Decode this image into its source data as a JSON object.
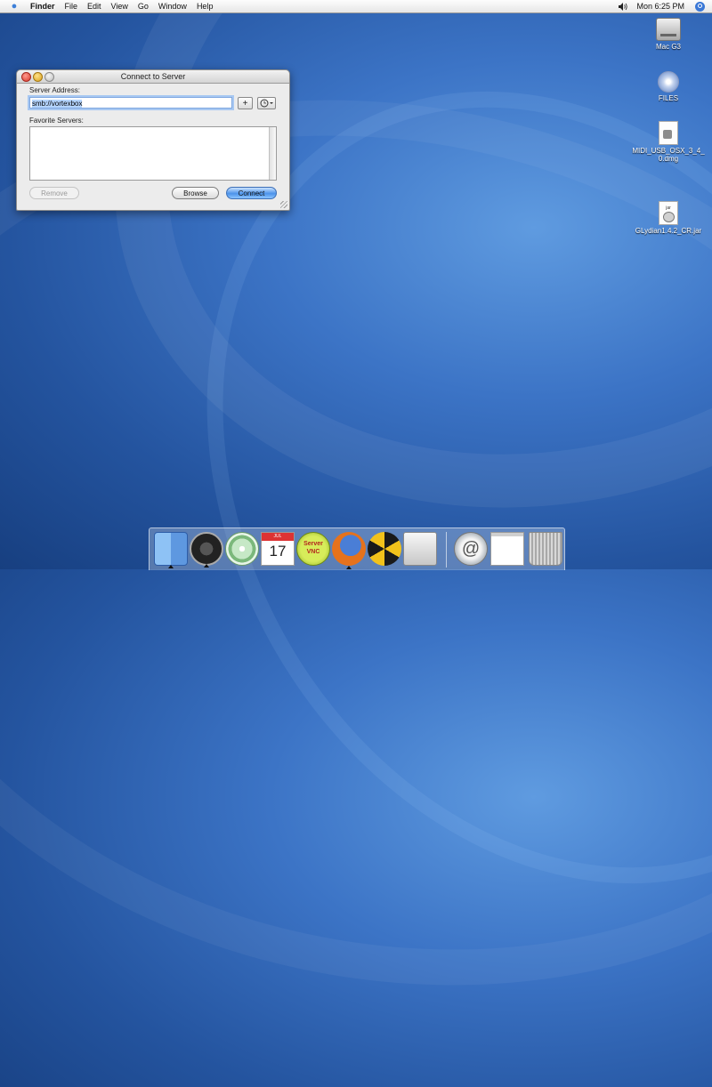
{
  "menubar": {
    "app_name": "Finder",
    "items": [
      "File",
      "Edit",
      "View",
      "Go",
      "Window",
      "Help"
    ],
    "clock": "Mon 6:25 PM"
  },
  "desktop_icons": [
    {
      "label": "Mac G3",
      "icon": "hard-drive-icon"
    },
    {
      "label": "FILES",
      "icon": "cd-icon"
    },
    {
      "label": "MIDI_USB_OSX_3_4_0.dmg",
      "icon": "disk-image-icon"
    },
    {
      "label": "GLydian1.4.2_CR.jar",
      "icon": "jar-file-icon"
    }
  ],
  "dialog": {
    "title": "Connect to Server",
    "server_address_label": "Server Address:",
    "server_address_value": "smb://vortexbox",
    "add_button_label": "+",
    "favorite_servers_label": "Favorite Servers:",
    "buttons": {
      "remove": "Remove",
      "browse": "Browse",
      "connect": "Connect"
    }
  },
  "dock": {
    "ical_date": "17",
    "ical_month": "JUL",
    "vnc_label": "Server VNC",
    "items": [
      "finder-icon",
      "dashboard-icon",
      "itunes-icon",
      "ical-icon",
      "vnc-server-icon",
      "firefox-icon",
      "radiation-app-icon",
      "system-preferences-icon",
      "mail-icon",
      "minimized-window-icon",
      "trash-icon"
    ]
  }
}
